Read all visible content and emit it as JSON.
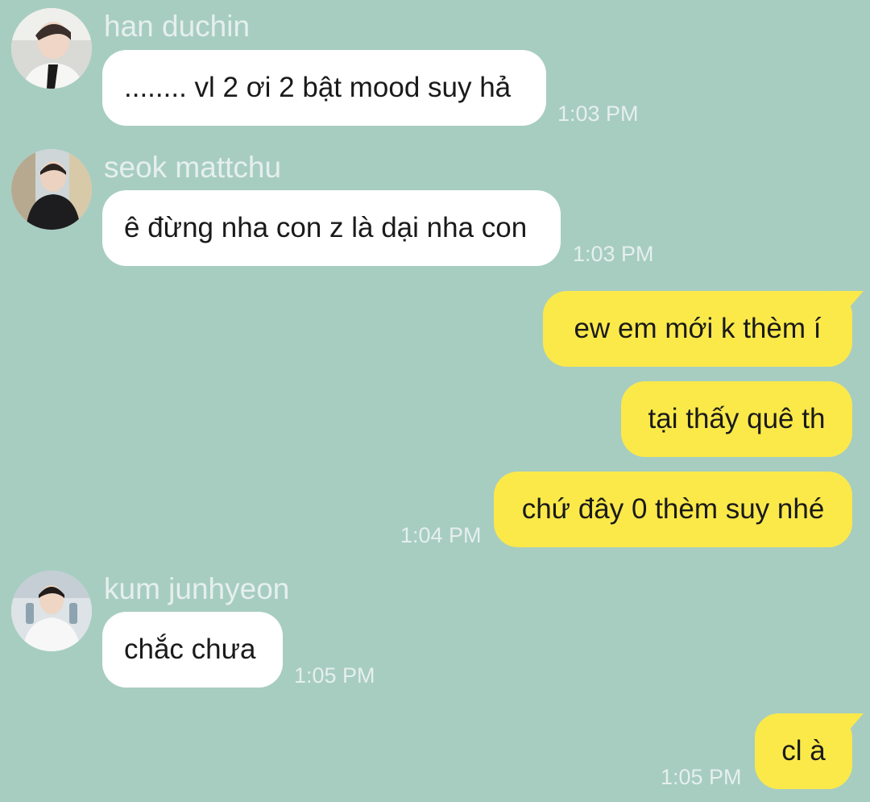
{
  "messages": [
    {
      "direction": "incoming",
      "sender": "han duchin",
      "avatar": "avatar-han-duchin",
      "text": "........ vl 2 ơi 2 bật mood suy hả",
      "time": "1:03 PM"
    },
    {
      "direction": "incoming",
      "sender": "seok mattchu",
      "avatar": "avatar-seok-mattchu",
      "text": "ê đừng nha con z là dại nha con",
      "time": "1:03 PM"
    },
    {
      "direction": "outgoing",
      "text": "ew em mới k thèm í"
    },
    {
      "direction": "outgoing",
      "text": "tại thấy quê th"
    },
    {
      "direction": "outgoing",
      "text": "chứ đây 0 thèm suy nhé",
      "time": "1:04 PM"
    },
    {
      "direction": "incoming",
      "sender": "kum junhyeon",
      "avatar": "avatar-kum-junhyeon",
      "text": "chắc chưa",
      "time": "1:05 PM"
    },
    {
      "direction": "outgoing",
      "text": "cl à",
      "time": "1:05 PM"
    }
  ],
  "colors": {
    "background": "#a7cdc1",
    "incoming_bubble": "#ffffff",
    "outgoing_bubble": "#fbe94a",
    "meta_text": "#e6efee",
    "message_text": "#1a1a1a"
  }
}
